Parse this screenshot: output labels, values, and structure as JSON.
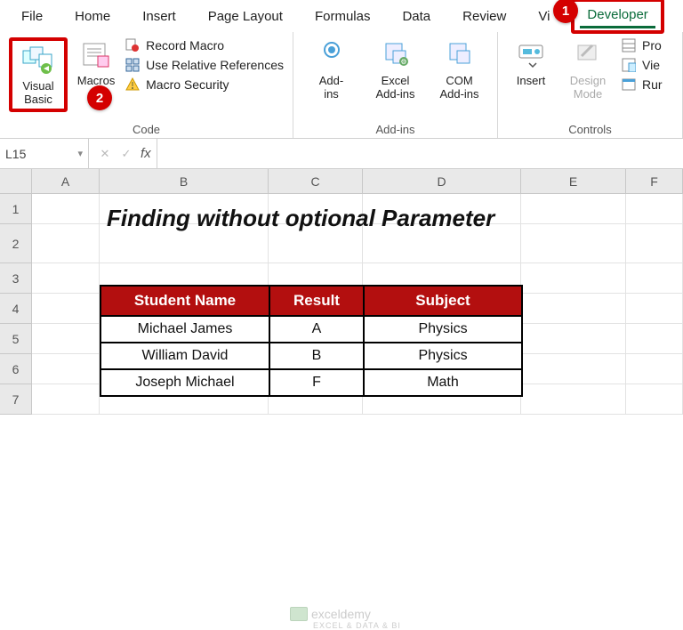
{
  "menu": {
    "file": "File",
    "home": "Home",
    "insert": "Insert",
    "page_layout": "Page Layout",
    "formulas": "Formulas",
    "data": "Data",
    "review": "Review",
    "view_partial": "Vi",
    "developer": "Developer"
  },
  "ribbon": {
    "code": {
      "visual_basic": "Visual\nBasic",
      "macros": "Macros",
      "record_macro": "Record Macro",
      "use_relative": "Use Relative References",
      "macro_security": "Macro Security",
      "group_title": "Code"
    },
    "addins": {
      "addins": "Add-\nins",
      "excel_addins": "Excel\nAdd-ins",
      "com_addins": "COM\nAdd-ins",
      "group_title": "Add-ins"
    },
    "controls": {
      "insert": "Insert",
      "design_mode": "Design\nMode",
      "properties": "Pro",
      "view_code": "Vie",
      "run_dialog": "Rur",
      "group_title": "Controls"
    }
  },
  "namebox": "L15",
  "fx": "fx",
  "columns": [
    "A",
    "B",
    "C",
    "D",
    "E",
    "F"
  ],
  "rows": [
    "1",
    "2",
    "3",
    "4",
    "5",
    "6",
    "7"
  ],
  "title": "Finding without optional Parameter",
  "table": {
    "headers": {
      "name": "Student Name",
      "result": "Result",
      "subject": "Subject"
    },
    "data": [
      {
        "name": "Michael James",
        "result": "A",
        "subject": "Physics"
      },
      {
        "name": "William David",
        "result": "B",
        "subject": "Physics"
      },
      {
        "name": "Joseph Michael",
        "result": "F",
        "subject": "Math"
      }
    ]
  },
  "badges": {
    "one": "1",
    "two": "2"
  },
  "watermark": {
    "name": "exceldemy",
    "sub": "EXCEL & DATA & BI"
  }
}
